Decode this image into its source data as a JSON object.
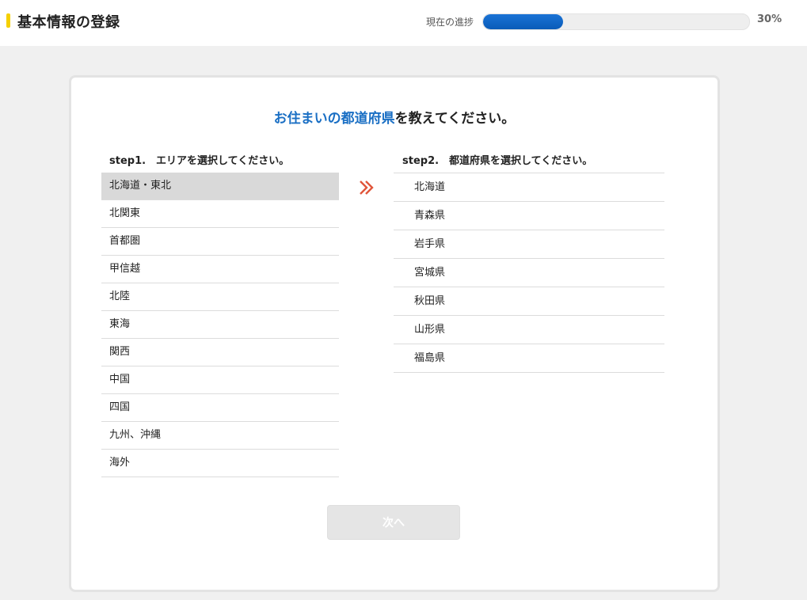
{
  "header": {
    "title": "基本情報の登録",
    "progress_label": "現在の進捗",
    "progress_percent_text": "30%",
    "progress_value": 0.3
  },
  "question": {
    "highlight": "お住まいの都道府県",
    "rest": "を教えてください。"
  },
  "step1": {
    "label": "step1.　エリアを選択してください。",
    "selected_index": 0,
    "areas": [
      "北海道・東北",
      "北関東",
      "首都圏",
      "甲信越",
      "北陸",
      "東海",
      "関西",
      "中国",
      "四国",
      "九州、沖縄",
      "海外"
    ]
  },
  "step2": {
    "label": "step2.　都道府県を選択してください。",
    "prefectures": [
      "北海道",
      "青森県",
      "岩手県",
      "宮城県",
      "秋田県",
      "山形県",
      "福島県"
    ]
  },
  "footer": {
    "next_label": "次へ"
  },
  "icons": {
    "arrow": "double-chevron-right-icon"
  },
  "colors": {
    "accent_blue": "#1a6fc4",
    "progress_blue": "#0a5bb8",
    "title_mark_yellow": "#f5d000",
    "arrow_red": "#e0553a",
    "selected_bg": "#d9d9d9",
    "disabled_button": "#e5e5e5"
  }
}
